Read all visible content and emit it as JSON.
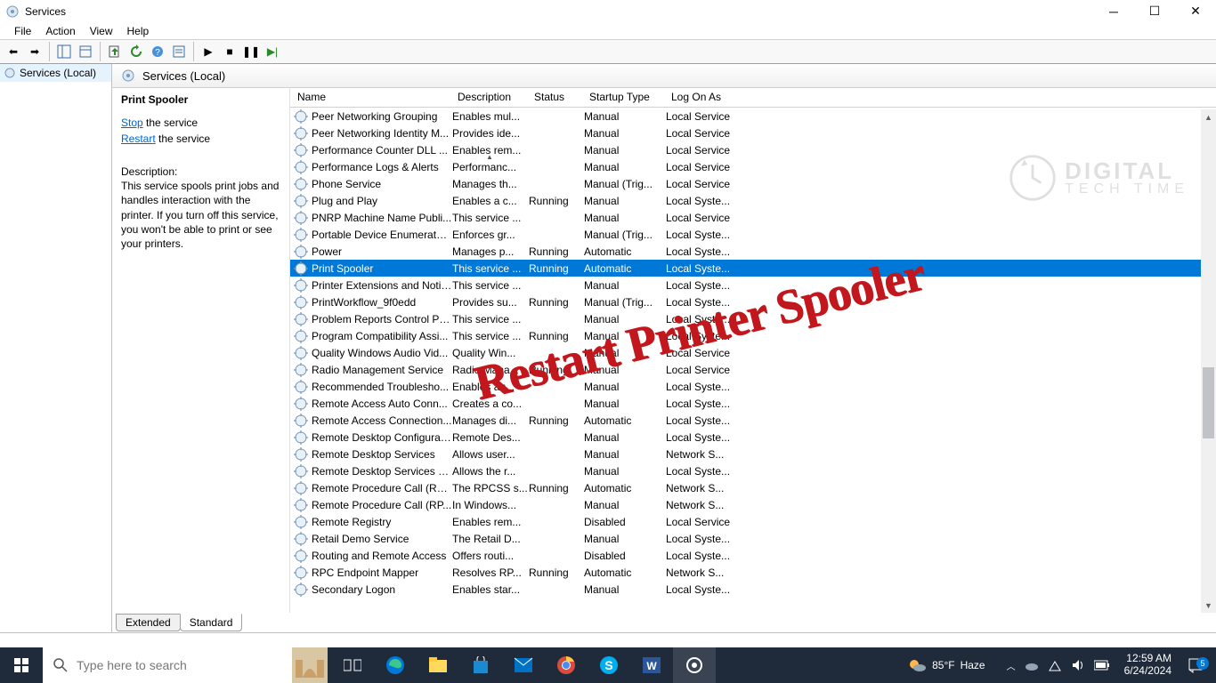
{
  "window": {
    "title": "Services"
  },
  "menus": [
    "File",
    "Action",
    "View",
    "Help"
  ],
  "tree": {
    "root": "Services (Local)"
  },
  "rightHeader": "Services (Local)",
  "detail": {
    "title": "Print Spooler",
    "stopLabel": "Stop",
    "stopSuffix": " the service",
    "restartLabel": "Restart",
    "restartSuffix": " the service",
    "descHeading": "Description:",
    "description": "This service spools print jobs and handles interaction with the printer. If you turn off this service, you won't be able to print or see your printers."
  },
  "columns": [
    "Name",
    "Description",
    "Status",
    "Startup Type",
    "Log On As"
  ],
  "services": [
    {
      "name": "Peer Networking Grouping",
      "desc": "Enables mul...",
      "status": "",
      "startup": "Manual",
      "logon": "Local Service"
    },
    {
      "name": "Peer Networking Identity M...",
      "desc": "Provides ide...",
      "status": "",
      "startup": "Manual",
      "logon": "Local Service"
    },
    {
      "name": "Performance Counter DLL ...",
      "desc": "Enables rem...",
      "status": "",
      "startup": "Manual",
      "logon": "Local Service"
    },
    {
      "name": "Performance Logs & Alerts",
      "desc": "Performanc...",
      "status": "",
      "startup": "Manual",
      "logon": "Local Service"
    },
    {
      "name": "Phone Service",
      "desc": "Manages th...",
      "status": "",
      "startup": "Manual (Trig...",
      "logon": "Local Service"
    },
    {
      "name": "Plug and Play",
      "desc": "Enables a c...",
      "status": "Running",
      "startup": "Manual",
      "logon": "Local Syste..."
    },
    {
      "name": "PNRP Machine Name Publi...",
      "desc": "This service ...",
      "status": "",
      "startup": "Manual",
      "logon": "Local Service"
    },
    {
      "name": "Portable Device Enumerator...",
      "desc": "Enforces gr...",
      "status": "",
      "startup": "Manual (Trig...",
      "logon": "Local Syste..."
    },
    {
      "name": "Power",
      "desc": "Manages p...",
      "status": "Running",
      "startup": "Automatic",
      "logon": "Local Syste..."
    },
    {
      "name": "Print Spooler",
      "desc": "This service ...",
      "status": "Running",
      "startup": "Automatic",
      "logon": "Local Syste...",
      "selected": true
    },
    {
      "name": "Printer Extensions and Notif...",
      "desc": "This service ...",
      "status": "",
      "startup": "Manual",
      "logon": "Local Syste..."
    },
    {
      "name": "PrintWorkflow_9f0edd",
      "desc": "Provides su...",
      "status": "Running",
      "startup": "Manual (Trig...",
      "logon": "Local Syste..."
    },
    {
      "name": "Problem Reports Control Pa...",
      "desc": "This service ...",
      "status": "",
      "startup": "Manual",
      "logon": "Local Syste..."
    },
    {
      "name": "Program Compatibility Assi...",
      "desc": "This service ...",
      "status": "Running",
      "startup": "Manual",
      "logon": "Local Syste..."
    },
    {
      "name": "Quality Windows Audio Vid...",
      "desc": "Quality Win...",
      "status": "",
      "startup": "Manual",
      "logon": "Local Service"
    },
    {
      "name": "Radio Management Service",
      "desc": "Radio Mana...",
      "status": "Running",
      "startup": "Manual",
      "logon": "Local Service"
    },
    {
      "name": "Recommended Troublesho...",
      "desc": "Enables au...",
      "status": "",
      "startup": "Manual",
      "logon": "Local Syste..."
    },
    {
      "name": "Remote Access Auto Conn...",
      "desc": "Creates a co...",
      "status": "",
      "startup": "Manual",
      "logon": "Local Syste..."
    },
    {
      "name": "Remote Access Connection...",
      "desc": "Manages di...",
      "status": "Running",
      "startup": "Automatic",
      "logon": "Local Syste..."
    },
    {
      "name": "Remote Desktop Configurat...",
      "desc": "Remote Des...",
      "status": "",
      "startup": "Manual",
      "logon": "Local Syste..."
    },
    {
      "name": "Remote Desktop Services",
      "desc": "Allows user...",
      "status": "",
      "startup": "Manual",
      "logon": "Network S..."
    },
    {
      "name": "Remote Desktop Services U...",
      "desc": "Allows the r...",
      "status": "",
      "startup": "Manual",
      "logon": "Local Syste..."
    },
    {
      "name": "Remote Procedure Call (RPC)",
      "desc": "The RPCSS s...",
      "status": "Running",
      "startup": "Automatic",
      "logon": "Network S..."
    },
    {
      "name": "Remote Procedure Call (RP...",
      "desc": "In Windows...",
      "status": "",
      "startup": "Manual",
      "logon": "Network S..."
    },
    {
      "name": "Remote Registry",
      "desc": "Enables rem...",
      "status": "",
      "startup": "Disabled",
      "logon": "Local Service"
    },
    {
      "name": "Retail Demo Service",
      "desc": "The Retail D...",
      "status": "",
      "startup": "Manual",
      "logon": "Local Syste..."
    },
    {
      "name": "Routing and Remote Access",
      "desc": "Offers routi...",
      "status": "",
      "startup": "Disabled",
      "logon": "Local Syste..."
    },
    {
      "name": "RPC Endpoint Mapper",
      "desc": "Resolves RP...",
      "status": "Running",
      "startup": "Automatic",
      "logon": "Network S..."
    },
    {
      "name": "Secondary Logon",
      "desc": "Enables star...",
      "status": "",
      "startup": "Manual",
      "logon": "Local Syste..."
    }
  ],
  "tabs": [
    "Extended",
    "Standard"
  ],
  "annotation": "Restart Printer Spooler",
  "watermark": {
    "line1": "DIGITAL",
    "line2": "TECH TIME"
  },
  "taskbar": {
    "searchPlaceholder": "Type here to search",
    "weather": {
      "temp": "85°F",
      "cond": "Haze"
    },
    "clock": {
      "time": "12:59 AM",
      "date": "6/24/2024"
    },
    "notifCount": "5"
  }
}
